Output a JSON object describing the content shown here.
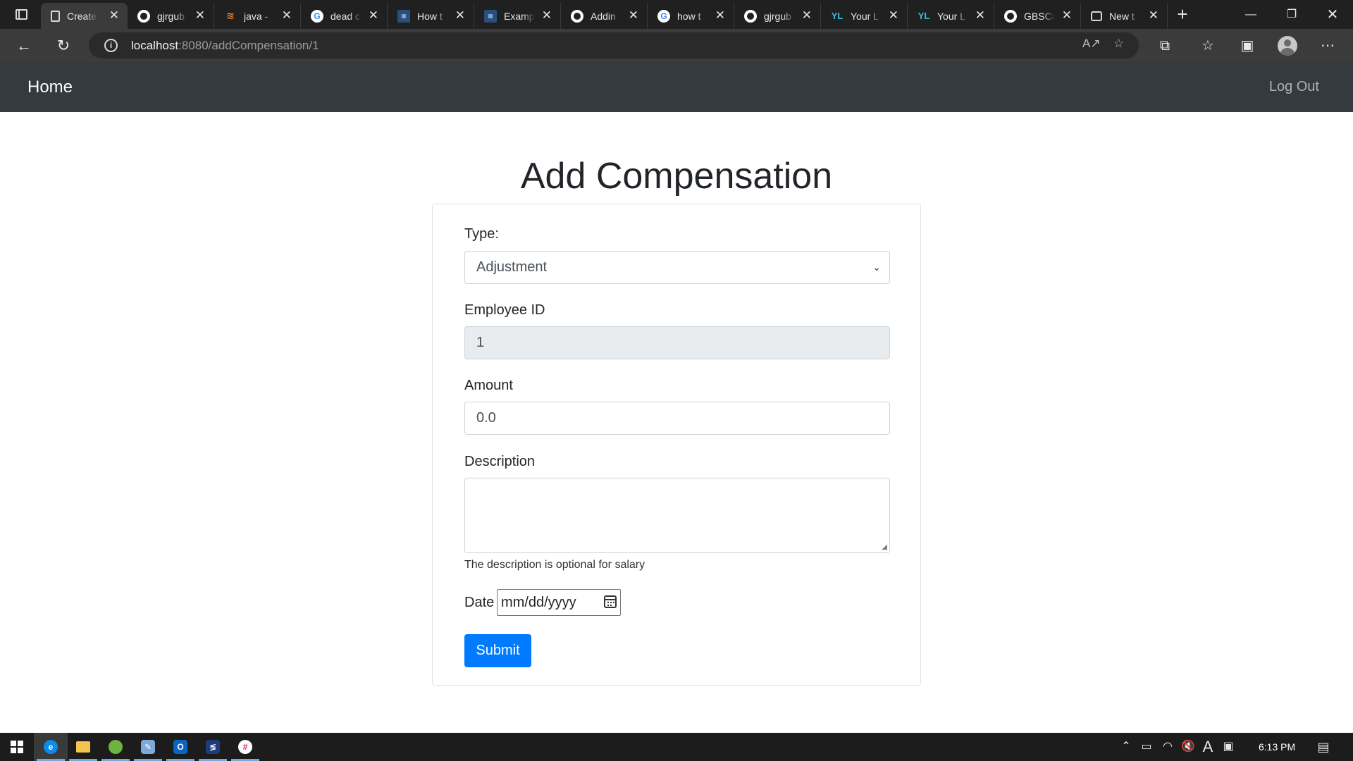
{
  "browser": {
    "tabs": [
      {
        "title": "Create",
        "icon": "page-icon",
        "active": true
      },
      {
        "title": "gjrgub",
        "icon": "github-icon"
      },
      {
        "title": "java -",
        "icon": "stackoverflow-icon"
      },
      {
        "title": "dead c",
        "icon": "google-icon"
      },
      {
        "title": "How t",
        "icon": "image-icon"
      },
      {
        "title": "Examp",
        "icon": "image-icon"
      },
      {
        "title": "Addin",
        "icon": "github-icon"
      },
      {
        "title": "how t",
        "icon": "google-icon"
      },
      {
        "title": "gjrgub",
        "icon": "github-icon"
      },
      {
        "title": "Your L",
        "icon": "yml-icon"
      },
      {
        "title": "Your L",
        "icon": "yml-icon"
      },
      {
        "title": "GBSCa",
        "icon": "github-icon"
      },
      {
        "title": "New t",
        "icon": "newtab-icon"
      }
    ],
    "url_host": "localhost",
    "url_path": ":8080/addCompensation/1"
  },
  "nav": {
    "brand": "Home",
    "logout": "Log Out"
  },
  "form": {
    "title": "Add Compensation",
    "type_label": "Type:",
    "type_value": "Adjustment",
    "employee_id_label": "Employee ID",
    "employee_id_value": "1",
    "amount_label": "Amount",
    "amount_value": "0.0",
    "description_label": "Description",
    "description_help": "The description is optional for salary",
    "date_label": "Date",
    "date_placeholder": "mm/dd/yyyy",
    "submit_label": "Submit"
  },
  "taskbar": {
    "time": "6:13 PM"
  },
  "colors": {
    "navbar": "#343a40",
    "primary": "#007bff",
    "disabled_input": "#e9ecef"
  }
}
